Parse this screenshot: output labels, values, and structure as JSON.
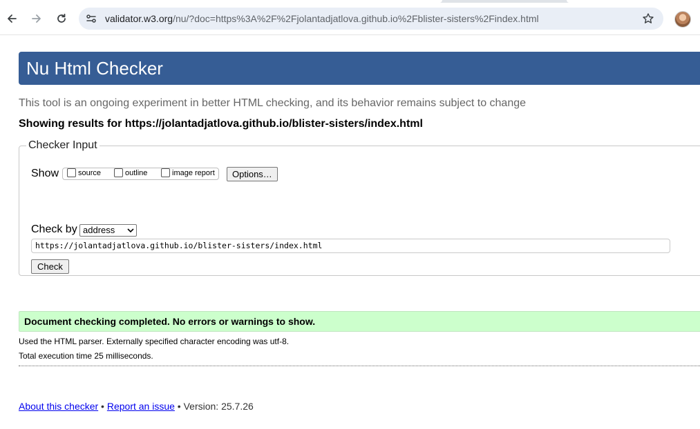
{
  "browser": {
    "url_domain": "validator.w3.org",
    "url_path": "/nu/?doc=https%3A%2F%2Fjolantadjatlova.github.io%2Fblister-sisters%2Findex.html"
  },
  "header": {
    "title": "Nu Html Checker"
  },
  "intro_text": "This tool is an ongoing experiment in better HTML checking, and its behavior remains subject to change",
  "showing_results": "Showing results for https://jolantadjatlova.github.io/blister-sisters/index.html",
  "checker_input": {
    "legend": "Checker Input",
    "show_label": "Show",
    "options": [
      {
        "label": "source",
        "checked": false
      },
      {
        "label": "outline",
        "checked": false
      },
      {
        "label": "image report",
        "checked": false
      }
    ],
    "options_button": "Options…",
    "check_by_label": "Check by",
    "check_by_value": "address",
    "url_value": "https://jolantadjatlova.github.io/blister-sisters/index.html",
    "check_button": "Check"
  },
  "result": {
    "message": "Document checking completed. No errors or warnings to show.",
    "parser_info": "Used the HTML parser. Externally specified character encoding was utf-8.",
    "execution_time": "Total execution time 25 milliseconds.",
    "status_color": "#ccffcc"
  },
  "footer": {
    "about_link": "About this checker",
    "sep1": " • ",
    "report_link": "Report an issue",
    "version": " • Version: 25.7.26"
  },
  "colors": {
    "banner": "#365d95",
    "link": "#0000ee"
  }
}
